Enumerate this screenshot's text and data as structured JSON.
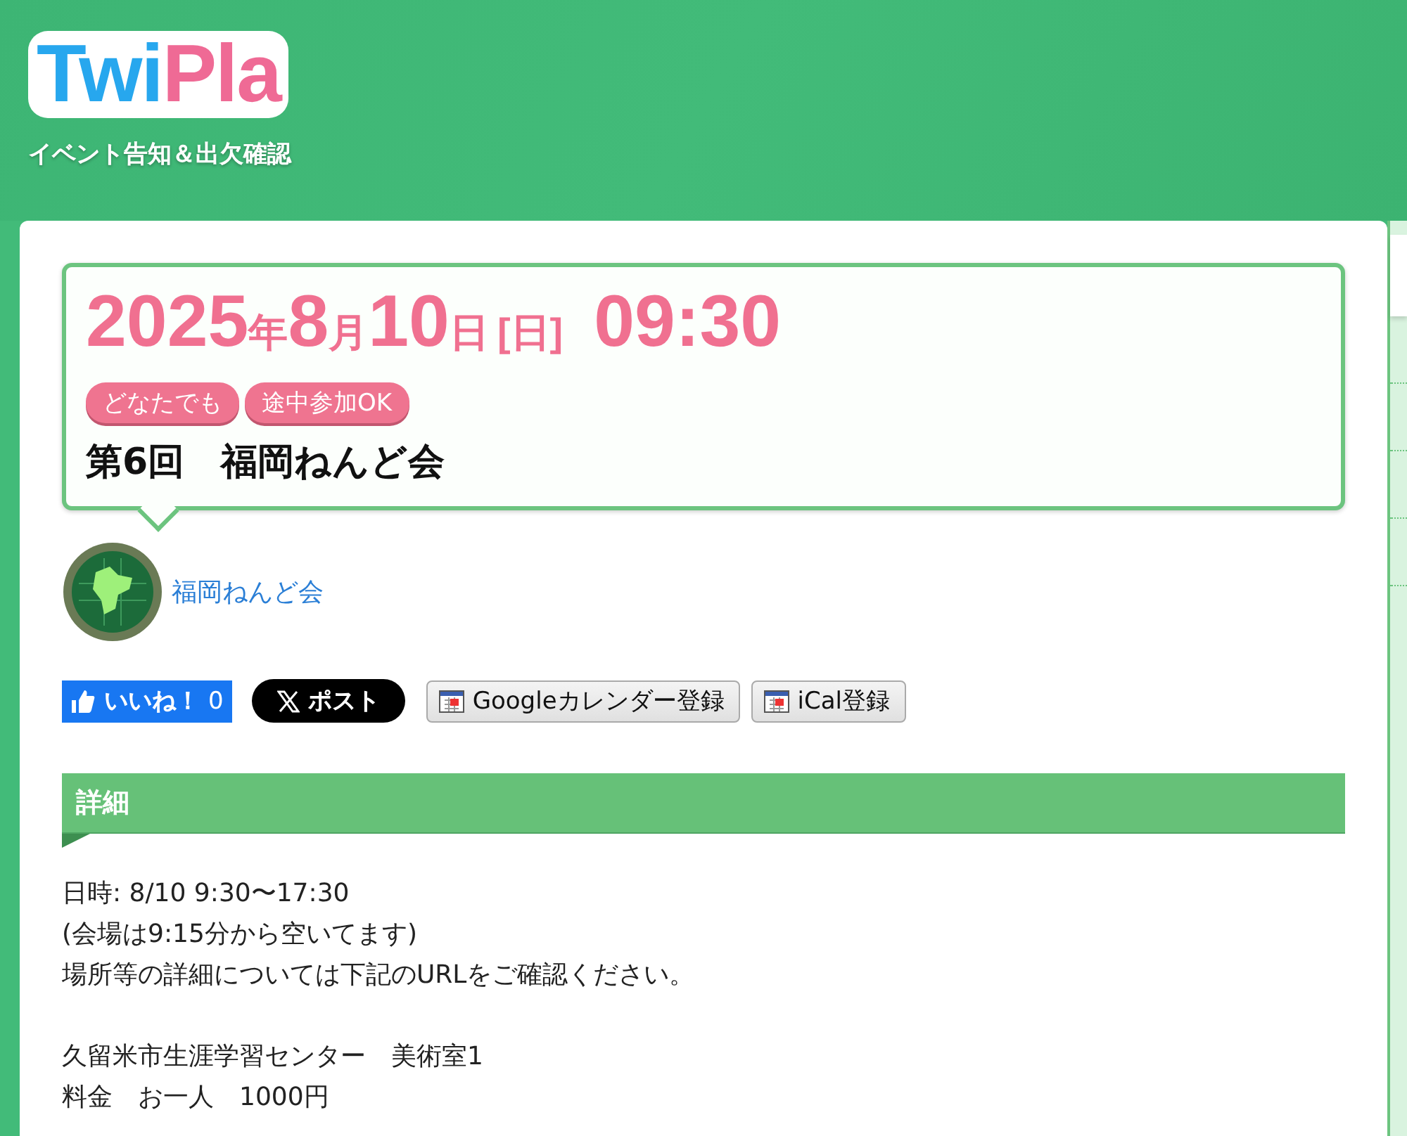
{
  "header": {
    "logo": [
      {
        "text": "Twi",
        "kind": "blue"
      },
      {
        "text": "Pla",
        "kind": "pink"
      }
    ],
    "tagline": "イベント告知＆出欠確認"
  },
  "event": {
    "date": [
      {
        "text": "2025",
        "kind": "number"
      },
      {
        "text": "年",
        "kind": "unit"
      },
      {
        "text": "8",
        "kind": "number"
      },
      {
        "text": "月",
        "kind": "unit"
      },
      {
        "text": "10",
        "kind": "number"
      },
      {
        "text": "日",
        "kind": "unit"
      },
      {
        "text": "[日]",
        "kind": "weekday"
      }
    ],
    "time": "09:30",
    "tags": [
      "どなたでも",
      "途中参加OK"
    ],
    "title": "第6回　福岡ねんど会"
  },
  "organizer": {
    "name": "福岡ねんど会"
  },
  "share": {
    "like_label": "いいね！",
    "like_count": "0",
    "post_label": "ポスト",
    "calendar_buttons": [
      "Googleカレンダー登録",
      "iCal登録"
    ]
  },
  "details": {
    "heading": "詳細",
    "paragraphs": [
      [
        "日時:  8/10 9:30〜17:30",
        "(会場は9:15分から空いてます)",
        "場所等の詳細については下記のURLをご確認ください。"
      ],
      [
        "久留米市生涯学習センター　美術室1",
        "料金　お一人　1000円"
      ]
    ]
  }
}
